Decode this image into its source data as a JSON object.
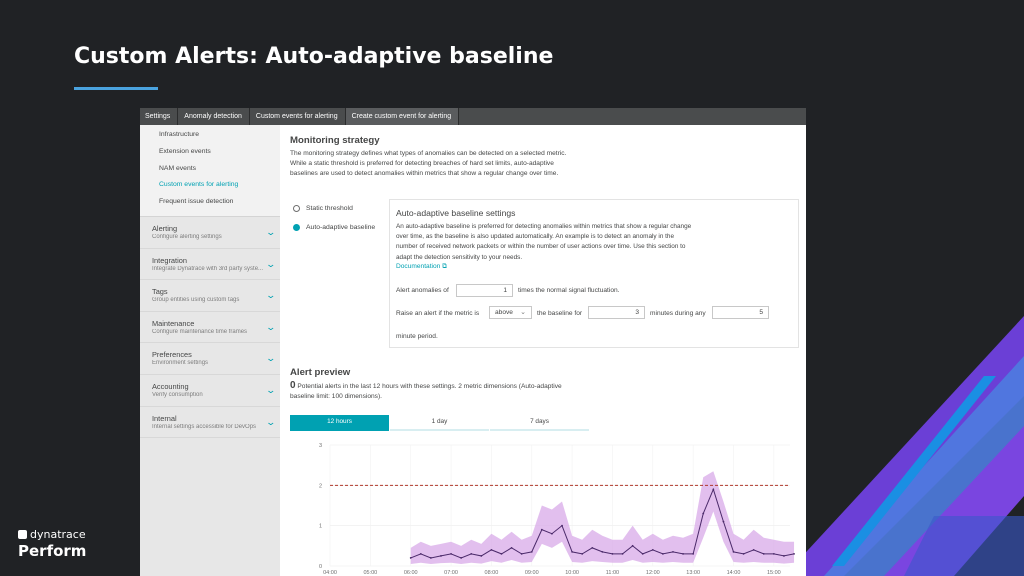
{
  "slide": {
    "title": "Custom Alerts: Auto-adaptive baseline",
    "brand_top": "dynatrace",
    "brand_name": "Perform"
  },
  "breadcrumb": [
    "Settings",
    "Anomaly detection",
    "Custom events for alerting",
    "Create custom event for alerting"
  ],
  "sidebar": {
    "subitems": [
      {
        "label": "Infrastructure",
        "active": false
      },
      {
        "label": "Extension events",
        "active": false
      },
      {
        "label": "NAM events",
        "active": false
      },
      {
        "label": "Custom events for alerting",
        "active": true
      },
      {
        "label": "Frequent issue detection",
        "active": false
      }
    ],
    "sections": [
      {
        "title": "Alerting",
        "desc": "Configure alerting settings"
      },
      {
        "title": "Integration",
        "desc": "Integrate Dynatrace with 3rd party syste..."
      },
      {
        "title": "Tags",
        "desc": "Group entities using custom tags"
      },
      {
        "title": "Maintenance",
        "desc": "Configure maintenance time frames"
      },
      {
        "title": "Preferences",
        "desc": "Environment settings"
      },
      {
        "title": "Accounting",
        "desc": "Verify consumption"
      },
      {
        "title": "Internal",
        "desc": "Internal settings accessible for DevOps"
      }
    ]
  },
  "monitoring": {
    "heading": "Monitoring strategy",
    "description": "The monitoring strategy defines what types of anomalies can be detected on a selected metric. While a static threshold is preferred for detecting breaches of hard set limits, auto-adaptive baselines are used to detect anomalies within metrics that show a regular change over time.",
    "options": [
      {
        "label": "Static threshold",
        "selected": false
      },
      {
        "label": "Auto-adaptive baseline",
        "selected": true
      }
    ]
  },
  "baseline": {
    "heading": "Auto-adaptive baseline settings",
    "description": "An auto-adaptive baseline is preferred for detecting anomalies within metrics that show a regular change over time, as the baseline is also updated automatically. An example is to detect an anomaly in the number of received network packets or within the number of user actions over time. Use this section to adapt the detection sensitivity to your needs.",
    "doc_link": "Documentation",
    "alert_label": "Alert anomalies of",
    "alert_value": "1",
    "alert_suffix": "times the normal signal fluctuation.",
    "raise_label": "Raise an alert if the metric is",
    "direction": "above",
    "baseline_for": "the baseline for",
    "minutes_value": "3",
    "minutes_label": "minutes during any",
    "period_value": "5",
    "period_label": "minute period."
  },
  "preview": {
    "heading": "Alert preview",
    "count": "0",
    "text": "Potential alerts in the last 12 hours with these settings. 2 metric dimensions (Auto-adaptive baseline limit: 100 dimensions).",
    "tabs": [
      {
        "label": "12 hours",
        "active": true
      },
      {
        "label": "1 day",
        "active": false
      },
      {
        "label": "7 days",
        "active": false
      }
    ]
  },
  "colors": {
    "accent": "#00a1b2",
    "series": "#4b2a6a",
    "band": "#d8a9e8",
    "threshold": "#b0392b"
  },
  "chart_data": {
    "type": "line",
    "x_ticks": [
      "04:00",
      "05:00",
      "06:00",
      "07:00",
      "08:00",
      "09:00",
      "10:00",
      "11:00",
      "12:00",
      "13:00",
      "14:00",
      "15:00"
    ],
    "y_ticks": [
      "0",
      "1",
      "2",
      "3"
    ],
    "ylim": [
      0,
      3
    ],
    "threshold": 2,
    "series": [
      {
        "x": [
          6.0,
          6.25,
          6.5,
          6.75,
          7.0,
          7.25,
          7.5,
          7.75,
          8.0,
          8.25,
          8.5,
          8.75,
          9.0,
          9.25,
          9.5,
          9.75,
          10.0,
          10.25,
          10.5,
          10.75,
          11.0,
          11.25,
          11.5,
          11.75,
          12.0,
          12.25,
          12.5,
          12.75,
          13.0,
          13.25,
          13.5,
          13.75,
          14.0,
          14.25,
          14.5,
          14.75,
          15.0,
          15.25,
          15.5
        ],
        "values": [
          0.2,
          0.3,
          0.2,
          0.25,
          0.3,
          0.2,
          0.3,
          0.25,
          0.4,
          0.3,
          0.45,
          0.3,
          0.35,
          0.9,
          0.8,
          1.0,
          0.35,
          0.3,
          0.45,
          0.35,
          0.3,
          0.3,
          0.5,
          0.3,
          0.4,
          0.3,
          0.35,
          0.3,
          0.3,
          1.3,
          1.9,
          1.1,
          0.35,
          0.3,
          0.4,
          0.3,
          0.3,
          0.25,
          0.3
        ],
        "band_high": [
          0.45,
          0.6,
          0.5,
          0.55,
          0.6,
          0.5,
          0.65,
          0.55,
          0.8,
          0.65,
          0.85,
          0.65,
          0.75,
          1.5,
          1.4,
          1.6,
          0.75,
          0.65,
          0.9,
          0.75,
          0.65,
          0.65,
          1.0,
          0.65,
          0.8,
          0.65,
          0.75,
          0.7,
          0.8,
          2.2,
          2.35,
          1.6,
          0.8,
          0.65,
          0.9,
          0.7,
          0.65,
          0.6,
          0.6
        ],
        "band_low": [
          0.05,
          0.08,
          0.05,
          0.07,
          0.08,
          0.05,
          0.08,
          0.06,
          0.12,
          0.08,
          0.15,
          0.08,
          0.1,
          0.55,
          0.45,
          0.6,
          0.1,
          0.08,
          0.12,
          0.1,
          0.08,
          0.08,
          0.15,
          0.08,
          0.1,
          0.08,
          0.1,
          0.08,
          0.08,
          0.7,
          1.35,
          0.6,
          0.1,
          0.08,
          0.1,
          0.08,
          0.08,
          0.06,
          0.08
        ]
      }
    ]
  }
}
